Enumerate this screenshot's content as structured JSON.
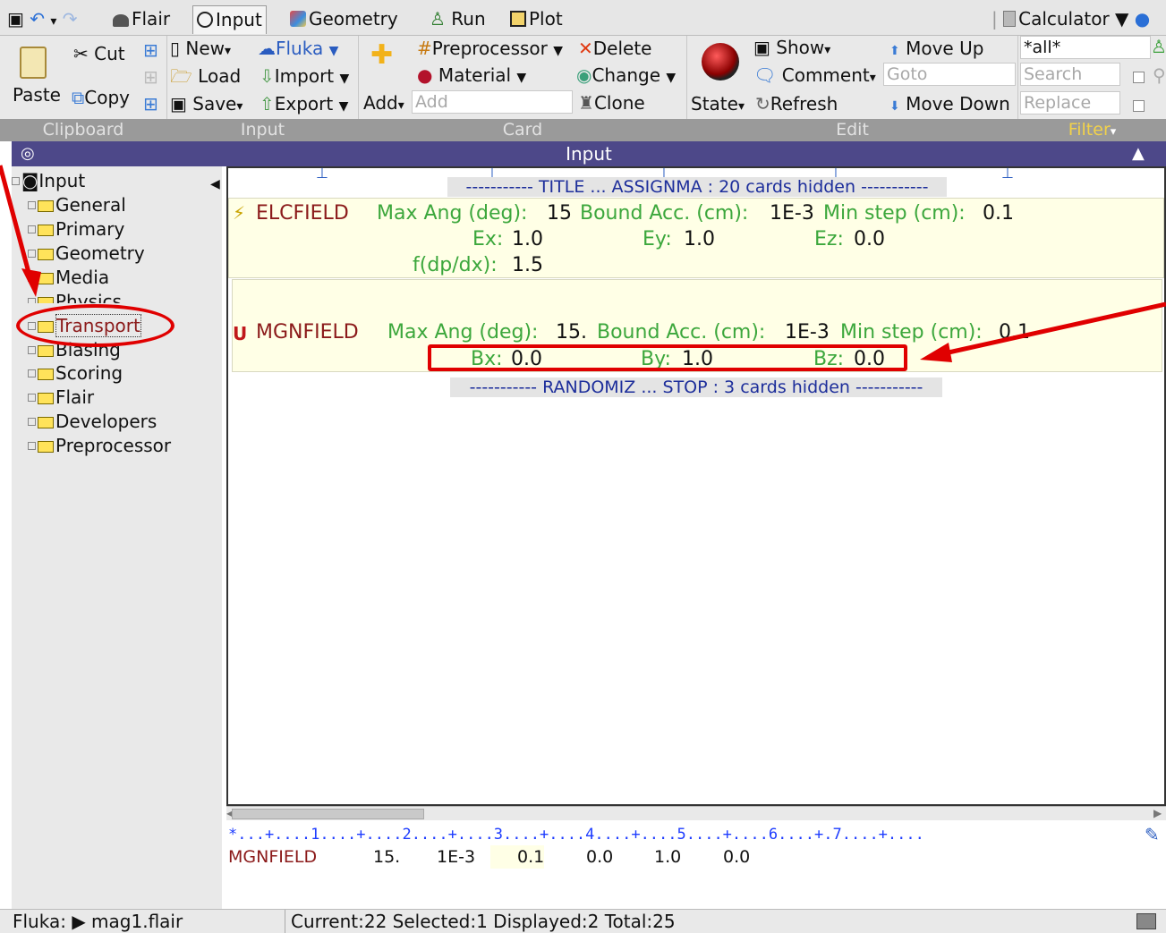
{
  "tabs": {
    "flair": "Flair",
    "input": "Input",
    "geometry": "Geometry",
    "run": "Run",
    "plot": "Plot",
    "calculator": "Calculator"
  },
  "ribbon": {
    "clipboard": {
      "cut": "Cut",
      "paste": "Paste",
      "copy": "Copy",
      "group": "Clipboard"
    },
    "input": {
      "new": "New",
      "fluka": "Fluka",
      "load": "Load",
      "import": "Import",
      "save": "Save",
      "export": "Export",
      "group": "Input"
    },
    "card": {
      "add": "Add",
      "add_placeholder": "Add",
      "preprocessor": "Preprocessor",
      "material": "Material",
      "delete": "Delete",
      "change": "Change",
      "clone": "Clone",
      "group": "Card"
    },
    "edit": {
      "state": "State",
      "show": "Show",
      "comment": "Comment",
      "refresh": "Refresh",
      "move_up": "Move Up",
      "move_down": "Move Down",
      "goto_placeholder": "Goto",
      "group": "Edit"
    },
    "filter": {
      "value": "*all*",
      "search_placeholder": "Search",
      "replace_placeholder": "Replace",
      "group": "Filter"
    }
  },
  "panel_title": "Input",
  "tree": {
    "root": "Input",
    "items": [
      "General",
      "Primary",
      "Geometry",
      "Media",
      "Physics",
      "Transport",
      "Biasing",
      "Scoring",
      "Flair",
      "Developers",
      "Preprocessor"
    ],
    "selected": "Transport"
  },
  "main": {
    "hidden_top": "----------- TITLE ... ASSIGNMA : 20 cards hidden -----------",
    "hidden_bottom": "----------- RANDOMIZ ... STOP : 3 cards hidden -----------",
    "elcfield": {
      "name": "ELCFIELD",
      "maxang_label": "Max Ang (deg):",
      "maxang": "15",
      "bound_label": "Bound Acc. (cm):",
      "bound": "1E-3",
      "minstep_label": "Min step (cm):",
      "minstep": "0.1",
      "ex_label": "Ex:",
      "ex": "1.0",
      "ey_label": "Ey:",
      "ey": "1.0",
      "ez_label": "Ez:",
      "ez": "0.0",
      "fdp_label": "f(dp/dx):",
      "fdp": "1.5"
    },
    "mgnfield": {
      "name": "MGNFIELD",
      "maxang_label": "Max Ang (deg):",
      "maxang": "15.",
      "bound_label": "Bound Acc. (cm):",
      "bound": "1E-3",
      "minstep_label": "Min step (cm):",
      "minstep": "0.1",
      "bx_label": "Bx:",
      "bx": "0.0",
      "by_label": "By:",
      "by": "1.0",
      "bz_label": "Bz:",
      "bz": "0.0"
    }
  },
  "editor": {
    "ruler": "*...+....1....+....2....+....3....+....4....+....5....+....6....+.7....+....",
    "card_name": "MGNFIELD",
    "values": [
      "15.",
      "1E-3",
      "0.1",
      "0.0",
      "1.0",
      "0.0"
    ]
  },
  "status": {
    "project": "Fluka: ▶ mag1.flair",
    "info": "Current:22 Selected:1 Displayed:2 Total:25"
  },
  "colors": {
    "header_purple": "#4d4889",
    "card_name": "#8b1a1a",
    "field_label": "#3ca73c",
    "hidden_text": "#1d2e9b",
    "annotation_red": "#e00000"
  }
}
